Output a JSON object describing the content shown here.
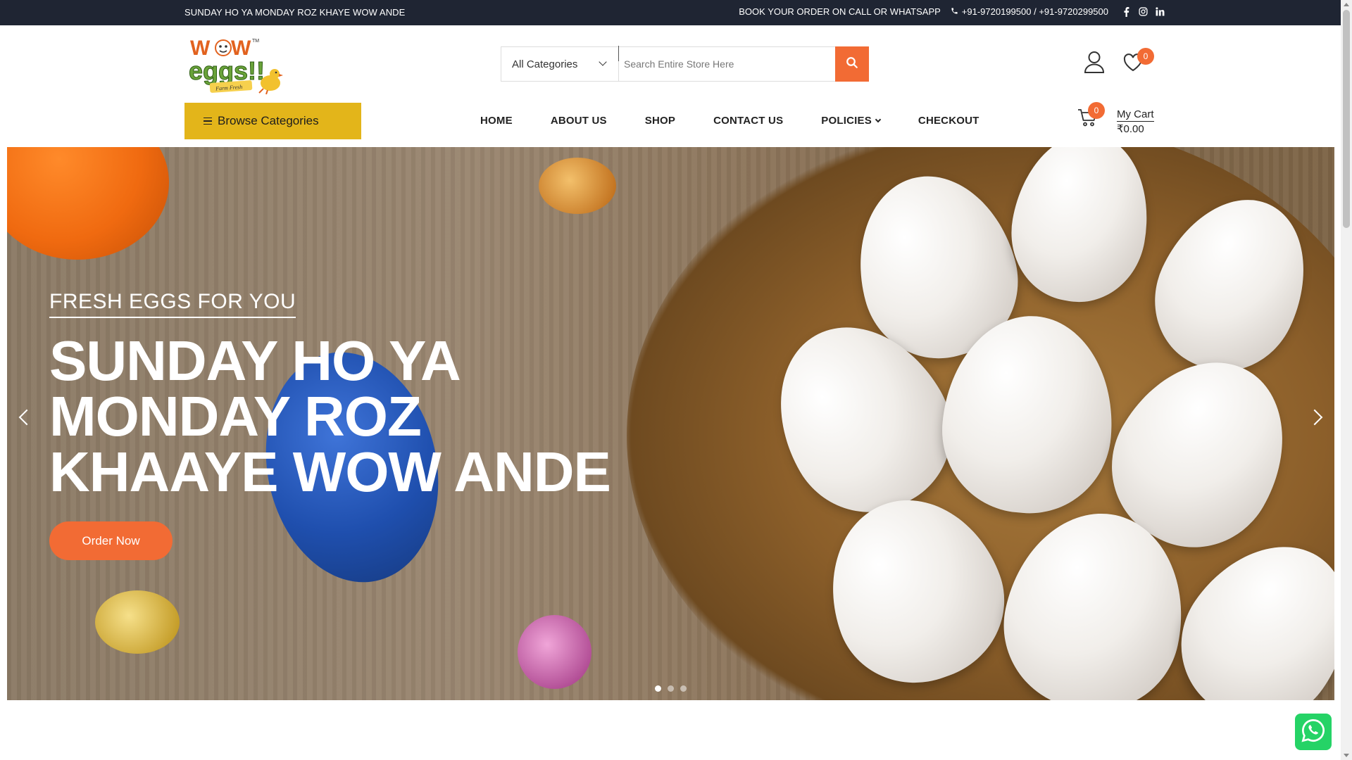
{
  "topbar": {
    "tagline": "SUNDAY HO YA MONDAY ROZ KHAYE WOW ANDE",
    "book_text": "BOOK YOUR ORDER ON CALL OR WHATSAPP",
    "phones": "+91-9720199500 / +91-9720299500",
    "social": [
      "facebook-icon",
      "instagram-icon",
      "linkedin-icon"
    ]
  },
  "header": {
    "logo_alt": "Wow eggs!!",
    "search": {
      "category": "All Categories",
      "placeholder": "Search Entire Store Here"
    },
    "wishlist_count": "0"
  },
  "nav": {
    "browse_label": "Browse Categories",
    "items": [
      {
        "label": "HOME"
      },
      {
        "label": "ABOUT US"
      },
      {
        "label": "SHOP"
      },
      {
        "label": "CONTACT US"
      },
      {
        "label": "POLICIES",
        "has_dropdown": true
      },
      {
        "label": "CHECKOUT"
      }
    ],
    "cart": {
      "count": "0",
      "label": "My Cart",
      "total": "₹0.00"
    }
  },
  "hero": {
    "subtitle": "FRESH EGGS FOR YOU",
    "title": "SUNDAY HO YA MONDAY ROZ KHAAYE WOW ANDE",
    "cta": "Order Now",
    "slides": 3,
    "active_slide": 1
  },
  "colors": {
    "topbar_bg": "#1f2533",
    "accent_orange": "#f26b34",
    "browse_yellow": "#e3b51a",
    "whatsapp_green": "#25d366"
  }
}
